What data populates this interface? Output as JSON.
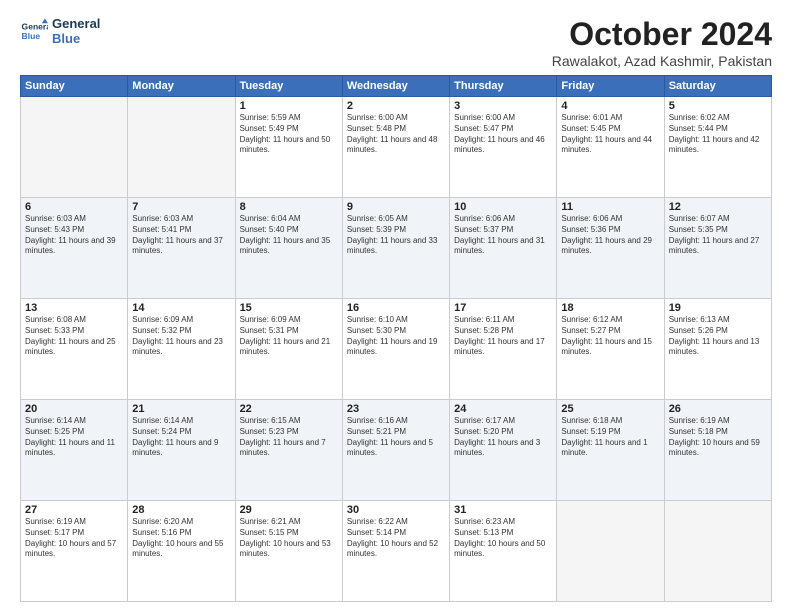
{
  "logo": {
    "line1": "General",
    "line2": "Blue"
  },
  "title": "October 2024",
  "location": "Rawalakot, Azad Kashmir, Pakistan",
  "headers": [
    "Sunday",
    "Monday",
    "Tuesday",
    "Wednesday",
    "Thursday",
    "Friday",
    "Saturday"
  ],
  "weeks": [
    [
      {
        "day": "",
        "sunrise": "",
        "sunset": "",
        "daylight": "",
        "empty": true
      },
      {
        "day": "",
        "sunrise": "",
        "sunset": "",
        "daylight": "",
        "empty": true
      },
      {
        "day": "1",
        "sunrise": "Sunrise: 5:59 AM",
        "sunset": "Sunset: 5:49 PM",
        "daylight": "Daylight: 11 hours and 50 minutes."
      },
      {
        "day": "2",
        "sunrise": "Sunrise: 6:00 AM",
        "sunset": "Sunset: 5:48 PM",
        "daylight": "Daylight: 11 hours and 48 minutes."
      },
      {
        "day": "3",
        "sunrise": "Sunrise: 6:00 AM",
        "sunset": "Sunset: 5:47 PM",
        "daylight": "Daylight: 11 hours and 46 minutes."
      },
      {
        "day": "4",
        "sunrise": "Sunrise: 6:01 AM",
        "sunset": "Sunset: 5:45 PM",
        "daylight": "Daylight: 11 hours and 44 minutes."
      },
      {
        "day": "5",
        "sunrise": "Sunrise: 6:02 AM",
        "sunset": "Sunset: 5:44 PM",
        "daylight": "Daylight: 11 hours and 42 minutes."
      }
    ],
    [
      {
        "day": "6",
        "sunrise": "Sunrise: 6:03 AM",
        "sunset": "Sunset: 5:43 PM",
        "daylight": "Daylight: 11 hours and 39 minutes."
      },
      {
        "day": "7",
        "sunrise": "Sunrise: 6:03 AM",
        "sunset": "Sunset: 5:41 PM",
        "daylight": "Daylight: 11 hours and 37 minutes."
      },
      {
        "day": "8",
        "sunrise": "Sunrise: 6:04 AM",
        "sunset": "Sunset: 5:40 PM",
        "daylight": "Daylight: 11 hours and 35 minutes."
      },
      {
        "day": "9",
        "sunrise": "Sunrise: 6:05 AM",
        "sunset": "Sunset: 5:39 PM",
        "daylight": "Daylight: 11 hours and 33 minutes."
      },
      {
        "day": "10",
        "sunrise": "Sunrise: 6:06 AM",
        "sunset": "Sunset: 5:37 PM",
        "daylight": "Daylight: 11 hours and 31 minutes."
      },
      {
        "day": "11",
        "sunrise": "Sunrise: 6:06 AM",
        "sunset": "Sunset: 5:36 PM",
        "daylight": "Daylight: 11 hours and 29 minutes."
      },
      {
        "day": "12",
        "sunrise": "Sunrise: 6:07 AM",
        "sunset": "Sunset: 5:35 PM",
        "daylight": "Daylight: 11 hours and 27 minutes."
      }
    ],
    [
      {
        "day": "13",
        "sunrise": "Sunrise: 6:08 AM",
        "sunset": "Sunset: 5:33 PM",
        "daylight": "Daylight: 11 hours and 25 minutes."
      },
      {
        "day": "14",
        "sunrise": "Sunrise: 6:09 AM",
        "sunset": "Sunset: 5:32 PM",
        "daylight": "Daylight: 11 hours and 23 minutes."
      },
      {
        "day": "15",
        "sunrise": "Sunrise: 6:09 AM",
        "sunset": "Sunset: 5:31 PM",
        "daylight": "Daylight: 11 hours and 21 minutes."
      },
      {
        "day": "16",
        "sunrise": "Sunrise: 6:10 AM",
        "sunset": "Sunset: 5:30 PM",
        "daylight": "Daylight: 11 hours and 19 minutes."
      },
      {
        "day": "17",
        "sunrise": "Sunrise: 6:11 AM",
        "sunset": "Sunset: 5:28 PM",
        "daylight": "Daylight: 11 hours and 17 minutes."
      },
      {
        "day": "18",
        "sunrise": "Sunrise: 6:12 AM",
        "sunset": "Sunset: 5:27 PM",
        "daylight": "Daylight: 11 hours and 15 minutes."
      },
      {
        "day": "19",
        "sunrise": "Sunrise: 6:13 AM",
        "sunset": "Sunset: 5:26 PM",
        "daylight": "Daylight: 11 hours and 13 minutes."
      }
    ],
    [
      {
        "day": "20",
        "sunrise": "Sunrise: 6:14 AM",
        "sunset": "Sunset: 5:25 PM",
        "daylight": "Daylight: 11 hours and 11 minutes."
      },
      {
        "day": "21",
        "sunrise": "Sunrise: 6:14 AM",
        "sunset": "Sunset: 5:24 PM",
        "daylight": "Daylight: 11 hours and 9 minutes."
      },
      {
        "day": "22",
        "sunrise": "Sunrise: 6:15 AM",
        "sunset": "Sunset: 5:23 PM",
        "daylight": "Daylight: 11 hours and 7 minutes."
      },
      {
        "day": "23",
        "sunrise": "Sunrise: 6:16 AM",
        "sunset": "Sunset: 5:21 PM",
        "daylight": "Daylight: 11 hours and 5 minutes."
      },
      {
        "day": "24",
        "sunrise": "Sunrise: 6:17 AM",
        "sunset": "Sunset: 5:20 PM",
        "daylight": "Daylight: 11 hours and 3 minutes."
      },
      {
        "day": "25",
        "sunrise": "Sunrise: 6:18 AM",
        "sunset": "Sunset: 5:19 PM",
        "daylight": "Daylight: 11 hours and 1 minute."
      },
      {
        "day": "26",
        "sunrise": "Sunrise: 6:19 AM",
        "sunset": "Sunset: 5:18 PM",
        "daylight": "Daylight: 10 hours and 59 minutes."
      }
    ],
    [
      {
        "day": "27",
        "sunrise": "Sunrise: 6:19 AM",
        "sunset": "Sunset: 5:17 PM",
        "daylight": "Daylight: 10 hours and 57 minutes."
      },
      {
        "day": "28",
        "sunrise": "Sunrise: 6:20 AM",
        "sunset": "Sunset: 5:16 PM",
        "daylight": "Daylight: 10 hours and 55 minutes."
      },
      {
        "day": "29",
        "sunrise": "Sunrise: 6:21 AM",
        "sunset": "Sunset: 5:15 PM",
        "daylight": "Daylight: 10 hours and 53 minutes."
      },
      {
        "day": "30",
        "sunrise": "Sunrise: 6:22 AM",
        "sunset": "Sunset: 5:14 PM",
        "daylight": "Daylight: 10 hours and 52 minutes."
      },
      {
        "day": "31",
        "sunrise": "Sunrise: 6:23 AM",
        "sunset": "Sunset: 5:13 PM",
        "daylight": "Daylight: 10 hours and 50 minutes."
      },
      {
        "day": "",
        "sunrise": "",
        "sunset": "",
        "daylight": "",
        "empty": true
      },
      {
        "day": "",
        "sunrise": "",
        "sunset": "",
        "daylight": "",
        "empty": true
      }
    ]
  ]
}
